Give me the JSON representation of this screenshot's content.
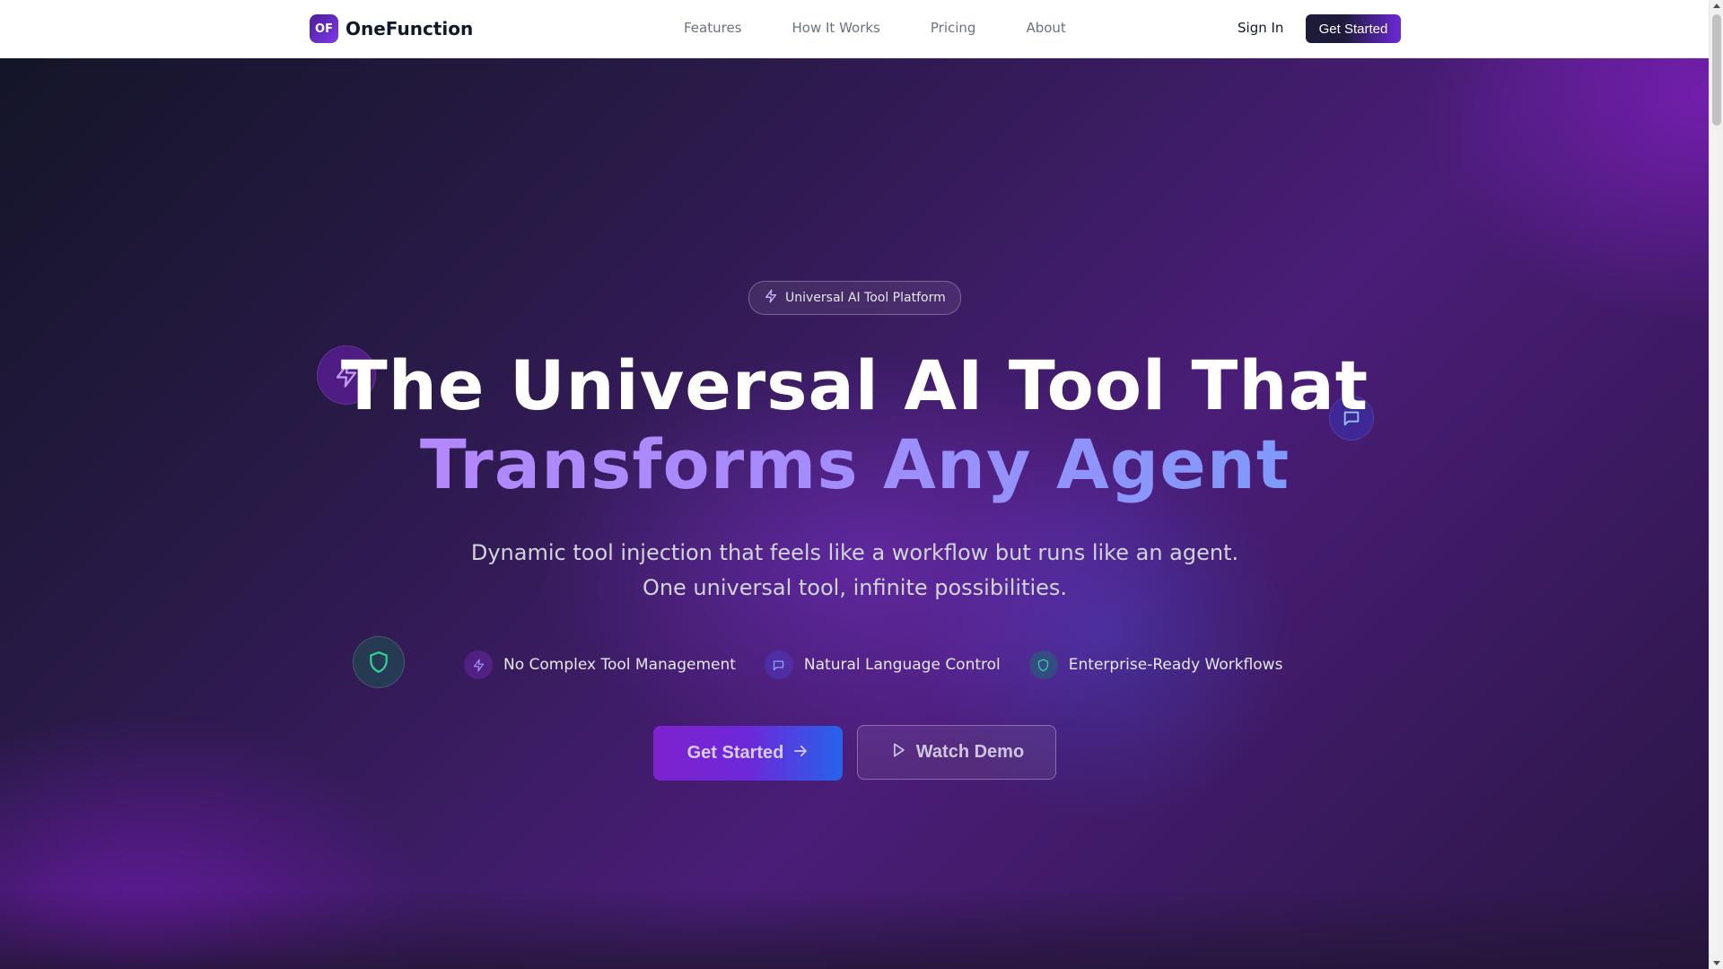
{
  "header": {
    "brand_initials": "OF",
    "brand_name": "OneFunction",
    "nav": [
      "Features",
      "How It Works",
      "Pricing",
      "About"
    ],
    "sign_in": "Sign In",
    "cta": "Get Started"
  },
  "hero": {
    "badge": "Universal AI Tool Platform",
    "title_line1": "The Universal AI Tool That",
    "title_line2": "Transforms Any Agent",
    "subtitle_line1": "Dynamic tool injection that feels like a workflow but runs like an agent.",
    "subtitle_line2": "One universal tool, infinite possibilities.",
    "features": [
      {
        "label": "No Complex Tool Management",
        "icon": "bolt-icon"
      },
      {
        "label": "Natural Language Control",
        "icon": "chat-icon"
      },
      {
        "label": "Enterprise-Ready Workflows",
        "icon": "shield-icon"
      }
    ],
    "primary_cta": "Get Started",
    "secondary_cta": "Watch Demo"
  },
  "colors": {
    "accent_purple": "#7e22ce",
    "accent_blue": "#2563eb",
    "heading_gradient_start": "#c084fc",
    "heading_gradient_end": "#60a5fa"
  }
}
